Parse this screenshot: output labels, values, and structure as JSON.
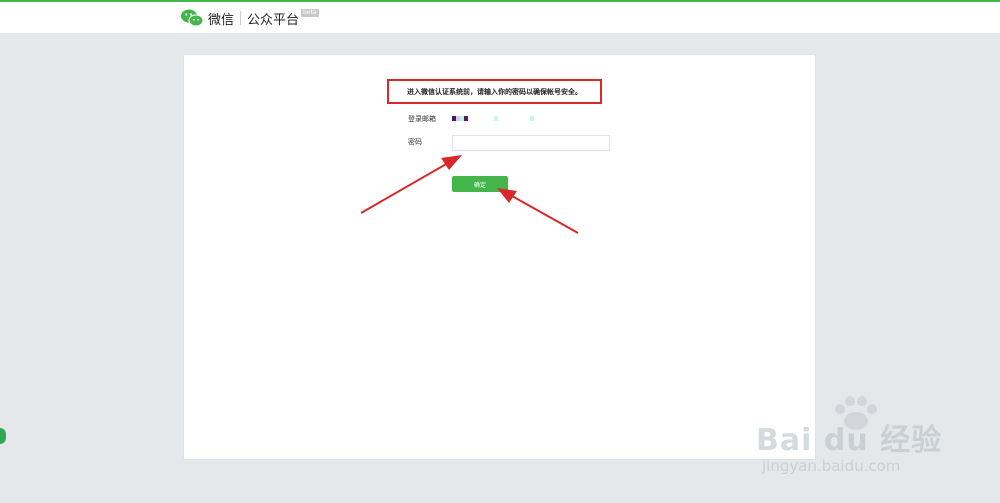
{
  "header": {
    "brand": "微信",
    "product": "公众平台",
    "badge": "beta"
  },
  "notice": {
    "text": "进入微信认证系统前，请输入你的密码以确保帐号安全。"
  },
  "form": {
    "email_label": "登录邮箱",
    "password_label": "密码",
    "password_value": "",
    "confirm_label": "确定"
  },
  "watermark": {
    "brand_text": "Bai du 经验",
    "url": "jingyan.baidu.com"
  },
  "colors": {
    "accent": "#44b549",
    "highlight_border": "#d9282a",
    "arrow": "#d9282a",
    "background": "#e4e8eb"
  }
}
